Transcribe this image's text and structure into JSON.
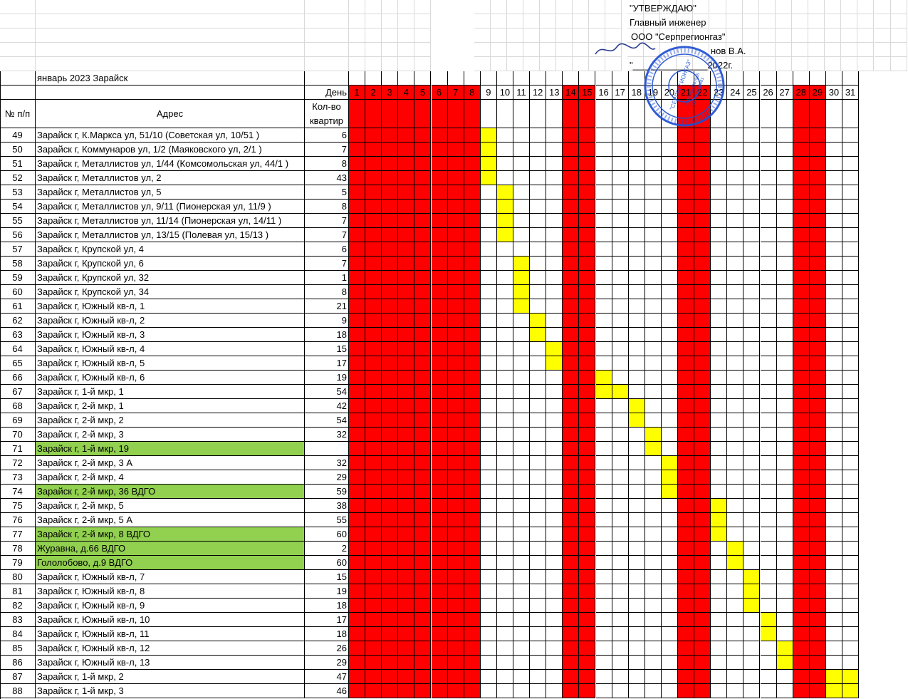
{
  "approval": {
    "line1": "\"УТВЕРЖДАЮ\"",
    "line2": "Главный инженер",
    "line3": "ООО \"Серпрегионгаз\"",
    "line4": "нов В.А.",
    "line5": "\"___ ___________2022г."
  },
  "stamp": {
    "center": "\"СЕРПРЕГИОНГАЗ\"",
    "inn": "ИНН 5043067965",
    "ogrn": "ОГРН 1185081"
  },
  "table": {
    "title": "январь 2023 Зарайск",
    "day_label": "День",
    "num_header": "№ п/п",
    "address_header": "Адрес",
    "qty_header_1": "Кол-во",
    "qty_header_2": "квартир",
    "days": [
      "1",
      "2",
      "3",
      "4",
      "5",
      "6",
      "7",
      "8",
      "9",
      "10",
      "11",
      "12",
      "13",
      "14",
      "15",
      "16",
      "17",
      "18",
      "19",
      "20",
      "21",
      "22",
      "23",
      "24",
      "25",
      "26",
      "27",
      "28",
      "29",
      "30",
      "31"
    ],
    "weekend_days": [
      1,
      2,
      3,
      4,
      5,
      6,
      7,
      8,
      14,
      15,
      21,
      22,
      28,
      29
    ],
    "rows": [
      {
        "n": "49",
        "address": "Зарайск г, К.Маркса ул, 51/10 (Советская ул, 10/51 )",
        "qty": "6",
        "days": [
          9
        ],
        "green": false
      },
      {
        "n": "50",
        "address": "Зарайск г, Коммунаров ул, 1/2 (Маяковского ул, 2/1 )",
        "qty": "7",
        "days": [
          9
        ],
        "green": false
      },
      {
        "n": "51",
        "address": "Зарайск г, Металлистов ул, 1/44 (Комсомольская ул, 44/1 )",
        "qty": "8",
        "days": [
          9
        ],
        "green": false
      },
      {
        "n": "52",
        "address": "Зарайск г, Металлистов ул, 2",
        "qty": "43",
        "days": [
          9
        ],
        "green": false
      },
      {
        "n": "53",
        "address": "Зарайск г, Металлистов ул, 5",
        "qty": "5",
        "days": [
          10
        ],
        "green": false
      },
      {
        "n": "54",
        "address": "Зарайск г, Металлистов ул, 9/11 (Пионерская ул, 11/9 )",
        "qty": "8",
        "days": [
          10
        ],
        "green": false
      },
      {
        "n": "55",
        "address": "Зарайск г, Металлистов ул, 11/14 (Пионерская ул, 14/11 )",
        "qty": "7",
        "days": [
          10
        ],
        "green": false
      },
      {
        "n": "56",
        "address": "Зарайск г, Металлистов ул, 13/15 (Полевая ул, 15/13 )",
        "qty": "7",
        "days": [
          10
        ],
        "green": false
      },
      {
        "n": "57",
        "address": "Зарайск г, Крупской ул, 4",
        "qty": "6",
        "days": [],
        "green": false
      },
      {
        "n": "58",
        "address": "Зарайск г, Крупской ул, 6",
        "qty": "7",
        "days": [
          11
        ],
        "green": false
      },
      {
        "n": "59",
        "address": "Зарайск г, Крупской ул, 32",
        "qty": "1",
        "days": [
          11
        ],
        "green": false
      },
      {
        "n": "60",
        "address": "Зарайск г, Крупской ул, 34",
        "qty": "8",
        "days": [
          11
        ],
        "green": false
      },
      {
        "n": "61",
        "address": "Зарайск г, Южный кв-л, 1",
        "qty": "21",
        "days": [
          11
        ],
        "green": false
      },
      {
        "n": "62",
        "address": "Зарайск г, Южный кв-л, 2",
        "qty": "9",
        "days": [
          12
        ],
        "green": false
      },
      {
        "n": "63",
        "address": "Зарайск г, Южный кв-л, 3",
        "qty": "18",
        "days": [
          12
        ],
        "green": false
      },
      {
        "n": "64",
        "address": "Зарайск г, Южный кв-л, 4",
        "qty": "15",
        "days": [
          13
        ],
        "green": false
      },
      {
        "n": "65",
        "address": "Зарайск г, Южный кв-л, 5",
        "qty": "17",
        "days": [
          13
        ],
        "green": false
      },
      {
        "n": "66",
        "address": "Зарайск г, Южный кв-л, 6",
        "qty": "19",
        "days": [
          16
        ],
        "green": false
      },
      {
        "n": "67",
        "address": "Зарайск г, 1-й мкр, 1",
        "qty": "54",
        "days": [
          16,
          17
        ],
        "green": false
      },
      {
        "n": "68",
        "address": "Зарайск г, 2-й мкр, 1",
        "qty": "42",
        "days": [
          18
        ],
        "green": false
      },
      {
        "n": "69",
        "address": "Зарайск г, 2-й мкр, 2",
        "qty": "54",
        "days": [
          18
        ],
        "green": false
      },
      {
        "n": "70",
        "address": "Зарайск г, 2-й мкр, 3",
        "qty": "32",
        "days": [
          19
        ],
        "green": false
      },
      {
        "n": "71",
        "address": "Зарайск г, 1-й мкр, 19",
        "qty": "",
        "days": [
          19
        ],
        "green": true
      },
      {
        "n": "72",
        "address": "Зарайск г, 2-й мкр, 3 А",
        "qty": "32",
        "days": [
          20
        ],
        "green": false
      },
      {
        "n": "73",
        "address": "Зарайск г, 2-й мкр, 4",
        "qty": "29",
        "days": [
          20
        ],
        "green": false
      },
      {
        "n": "74",
        "address": "Зарайск г, 2-й мкр, 36 ВДГО",
        "qty": "59",
        "days": [
          20
        ],
        "green": true
      },
      {
        "n": "75",
        "address": "Зарайск г, 2-й мкр, 5",
        "qty": "38",
        "days": [
          23
        ],
        "green": false
      },
      {
        "n": "76",
        "address": "Зарайск г, 2-й мкр, 5 А",
        "qty": "55",
        "days": [
          23
        ],
        "green": false
      },
      {
        "n": "77",
        "address": "Зарайск г, 2-й мкр, 8 ВДГО",
        "qty": "60",
        "days": [
          23
        ],
        "green": true
      },
      {
        "n": "78",
        "address": "Журавна, д.66 ВДГО",
        "qty": "2",
        "days": [
          24
        ],
        "green": true
      },
      {
        "n": "79",
        "address": "Гололобово, д.9 ВДГО",
        "qty": "60",
        "days": [
          24
        ],
        "green": true
      },
      {
        "n": "80",
        "address": "Зарайск г, Южный кв-л, 7",
        "qty": "15",
        "days": [
          25
        ],
        "green": false
      },
      {
        "n": "81",
        "address": "Зарайск г, Южный кв-л, 8",
        "qty": "19",
        "days": [
          25
        ],
        "green": false
      },
      {
        "n": "82",
        "address": "Зарайск г, Южный кв-л, 9",
        "qty": "18",
        "days": [
          25
        ],
        "green": false
      },
      {
        "n": "83",
        "address": "Зарайск г, Южный кв-л, 10",
        "qty": "17",
        "days": [
          26
        ],
        "green": false
      },
      {
        "n": "84",
        "address": "Зарайск г, Южный кв-л, 11",
        "qty": "18",
        "days": [
          26
        ],
        "green": false
      },
      {
        "n": "85",
        "address": "Зарайск г, Южный кв-л, 12",
        "qty": "26",
        "days": [
          27
        ],
        "green": false
      },
      {
        "n": "86",
        "address": "Зарайск г, Южный кв-л, 13",
        "qty": "29",
        "days": [
          27
        ],
        "green": false
      },
      {
        "n": "87",
        "address": "Зарайск г, 1-й мкр, 2",
        "qty": "47",
        "days": [
          30,
          31
        ],
        "green": false
      },
      {
        "n": "88",
        "address": "Зарайск г, 1-й мкр, 3",
        "qty": "46",
        "days": [
          30,
          31
        ],
        "green": false
      }
    ]
  },
  "colors": {
    "weekend": "#ff0000",
    "scheduled": "#ffff00",
    "green_row": "#92d050",
    "stamp": "#1f4fd1"
  }
}
